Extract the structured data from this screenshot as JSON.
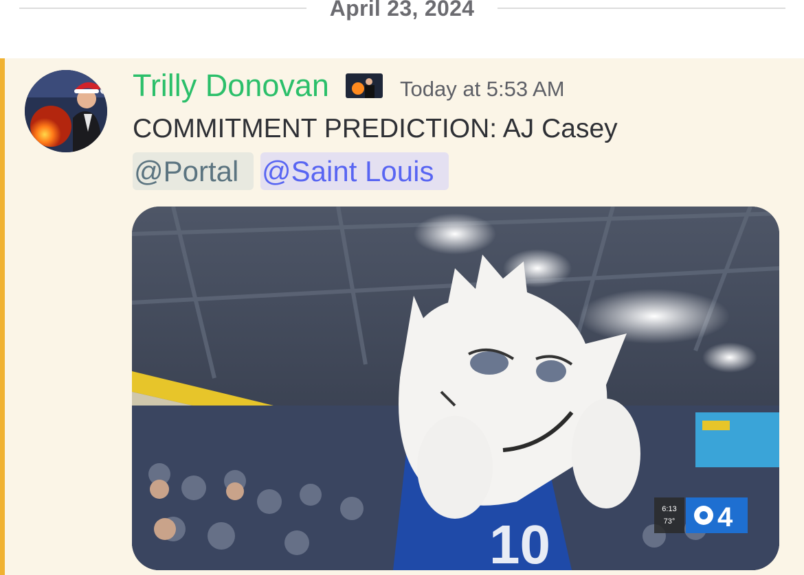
{
  "divider": {
    "date": "April 23, 2024"
  },
  "message": {
    "author": {
      "name": "Trilly Donovan",
      "name_color": "#2bbf6a",
      "avatar": "avatar-image",
      "role_icon": "role-badge-image"
    },
    "timestamp": "Today at 5:53 AM",
    "content": "COMMITMENT PREDICTION: AJ Casey",
    "mentions": [
      {
        "label": "@Portal",
        "color": "#5b7480"
      },
      {
        "label": "@Saint Louis",
        "color": "#5865f2"
      }
    ],
    "highlight_color": "#f0b232",
    "embed": {
      "type": "gif",
      "broadcast_overlay": {
        "score_time": "6:13",
        "score_temp": "73°",
        "network": "CBS4"
      }
    }
  }
}
